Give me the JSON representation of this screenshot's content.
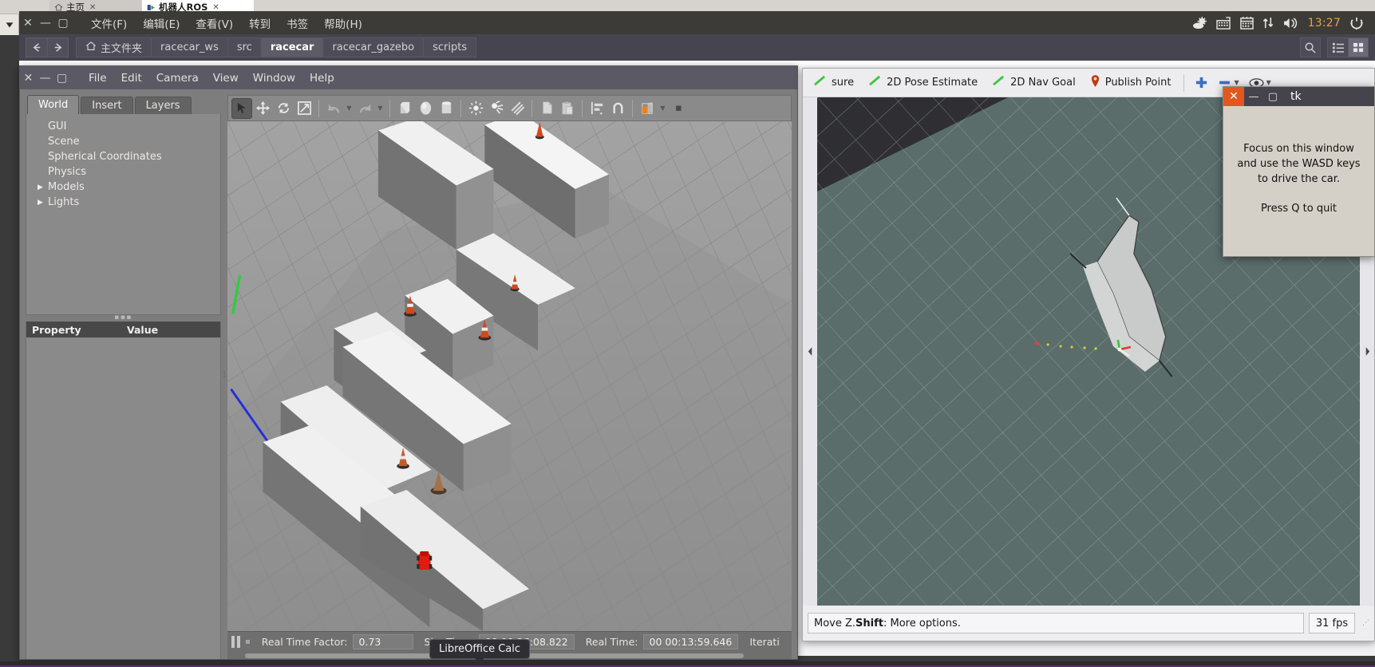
{
  "browser": {
    "tabs": [
      {
        "label": "主页",
        "icon": "home-icon",
        "active": false
      },
      {
        "label": "机器人ROS",
        "icon": "ros-icon",
        "active": true
      }
    ],
    "close_glyph": "✕",
    "scroll_arrow_icon": "chevron-down-icon"
  },
  "file_manager": {
    "window_buttons": {
      "close": "✕",
      "minimize": "—",
      "maximize": "▢"
    },
    "menus": [
      "文件(F)",
      "编辑(E)",
      "查看(V)",
      "转到",
      "书签",
      "帮助(H)"
    ],
    "tray": {
      "icons": [
        "ros-bug-icon",
        "keyboard-icon",
        "calendar-icon",
        "network-updown-icon",
        "volume-icon"
      ],
      "clock": "13:27",
      "clock_color": "#e8a33d",
      "power_icon": "power-gear-icon"
    },
    "nav": {
      "back_icon": "arrow-left-icon",
      "forward_icon": "arrow-right-icon"
    },
    "breadcrumbs": [
      {
        "label": "主文件夹",
        "icon": "home-icon",
        "current": false
      },
      {
        "label": "racecar_ws",
        "current": false
      },
      {
        "label": "src",
        "current": false
      },
      {
        "label": "racecar",
        "current": true
      },
      {
        "label": "racecar_gazebo",
        "current": false
      },
      {
        "label": "scripts",
        "current": false
      }
    ],
    "right_buttons": [
      {
        "name": "search-icon"
      },
      {
        "name": "list-view-icon"
      },
      {
        "name": "grid-view-icon"
      }
    ],
    "files": [
      {
        "icon": "document-icon"
      },
      {
        "icon": "document-icon"
      }
    ]
  },
  "gazebo": {
    "window_buttons": {
      "close": "✕",
      "minimize": "—",
      "maximize": "▢"
    },
    "menus": [
      "File",
      "Edit",
      "Camera",
      "View",
      "Window",
      "Help"
    ],
    "tabs": [
      {
        "label": "World",
        "active": true
      },
      {
        "label": "Insert",
        "active": false
      },
      {
        "label": "Layers",
        "active": false
      }
    ],
    "tree": [
      {
        "label": "GUI",
        "expandable": false
      },
      {
        "label": "Scene",
        "expandable": false
      },
      {
        "label": "Spherical Coordinates",
        "expandable": false
      },
      {
        "label": "Physics",
        "expandable": false
      },
      {
        "label": "Models",
        "expandable": true
      },
      {
        "label": "Lights",
        "expandable": true
      }
    ],
    "property_table": {
      "columns": [
        "Property",
        "Value"
      ]
    },
    "toolbar": [
      {
        "name": "select-tool",
        "active": true
      },
      {
        "name": "translate-tool",
        "active": false
      },
      {
        "name": "rotate-tool",
        "active": false
      },
      {
        "name": "scale-tool",
        "active": false
      },
      {
        "name": "undo-button",
        "active": false
      },
      {
        "name": "redo-button",
        "active": false
      },
      {
        "name": "insert-box-button",
        "active": false
      },
      {
        "name": "insert-sphere-button",
        "active": false
      },
      {
        "name": "insert-cylinder-button",
        "active": false
      },
      {
        "name": "point-light-button",
        "active": false
      },
      {
        "name": "spot-light-button",
        "active": false
      },
      {
        "name": "directional-light-button",
        "active": false
      },
      {
        "name": "copy-button",
        "active": false
      },
      {
        "name": "paste-button",
        "active": false
      },
      {
        "name": "align-button",
        "active": false
      },
      {
        "name": "snap-button",
        "active": false
      },
      {
        "name": "view-layers-button",
        "active": false
      }
    ],
    "status": {
      "pause_icon": "pause-icon",
      "step_icon": "step-icon",
      "real_time_factor_label": "Real Time Factor:",
      "real_time_factor_value": "0.73",
      "sim_time_label": "Sim Time:",
      "sim_time_value": "00 00:26:08.822",
      "real_time_label": "Real Time:",
      "real_time_value": "00 00:13:59.646",
      "iterations_label": "Iterati"
    }
  },
  "rviz": {
    "toolbar": [
      {
        "label": "sure",
        "icon": "measure-icon",
        "clipped": true
      },
      {
        "label": "2D Pose Estimate",
        "icon": "pose-arrow-icon"
      },
      {
        "label": "2D Nav Goal",
        "icon": "nav-goal-arrow-icon"
      },
      {
        "label": "Publish Point",
        "icon": "map-pin-icon"
      }
    ],
    "mini_buttons": [
      {
        "name": "add-tool-icon",
        "glyph": "✛"
      },
      {
        "name": "remove-tool-icon",
        "glyph": "▬"
      },
      {
        "name": "visibility-eye-icon",
        "glyph": "◉"
      }
    ],
    "left_collapse_icon": "chevron-left-icon",
    "right_collapse_icon": "chevron-right-icon",
    "status_text_prefix": "Move Z. ",
    "status_text_bold": "Shift",
    "status_text_suffix": ": More options.",
    "fps": "31 fps",
    "scene_bg_color": "#5a6d6a"
  },
  "tk_dialog": {
    "title": "tk",
    "window_buttons": {
      "close": "✕",
      "minimize": "—",
      "maximize": "▢"
    },
    "close_color": "#e2571e",
    "message_line1": "Focus on this window",
    "message_line2": "and use the WASD keys",
    "message_line3": "to drive the car.",
    "quit_text": "Press Q to quit"
  },
  "taskbar": {
    "tooltip": "LibreOffice Calc",
    "accent_color": "#5b2a6e"
  }
}
